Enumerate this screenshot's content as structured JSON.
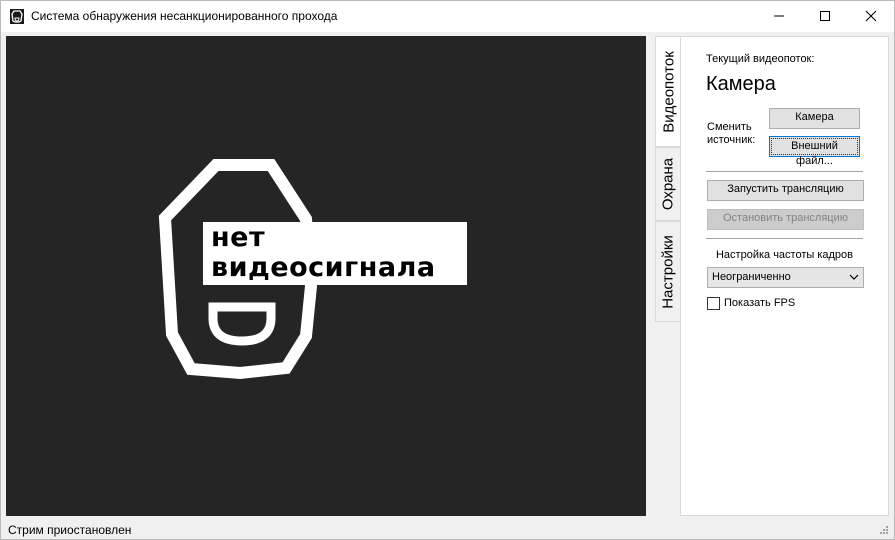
{
  "window": {
    "title": "Система обнаружения несанкционированного прохода",
    "icons": [
      "app-icon",
      "minimize-icon",
      "maximize-icon",
      "close-icon"
    ]
  },
  "video": {
    "placeholder_line1": "нет",
    "placeholder_line2": "видеосигнала",
    "background_color": "#252525"
  },
  "tabs": [
    {
      "label": "Видеопоток",
      "active": true
    },
    {
      "label": "Охрана",
      "active": false
    },
    {
      "label": "Настройки",
      "active": false
    }
  ],
  "panel": {
    "current_stream_label": "Текущий видеопоток:",
    "current_stream_value": "Камера",
    "switch_source_label": "Сменить источник:",
    "camera_button": "Камера",
    "file_button": "Внешний файл...",
    "start_button": "Запустить трансляцию",
    "stop_button": "Остановить трансляцию",
    "fps_label": "Настройка частоты кадров",
    "fps_selected": "Неограниченно",
    "show_fps_label": "Показать FPS",
    "show_fps_checked": false
  },
  "status": {
    "text": "Стрим приостановлен"
  }
}
